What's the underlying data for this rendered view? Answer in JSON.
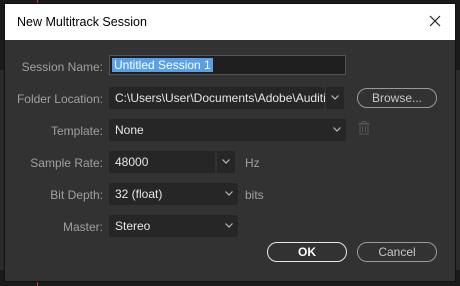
{
  "dialog": {
    "title": "New Multitrack Session",
    "close_icon": "close-icon"
  },
  "form": {
    "session_name_label": "Session Name:",
    "session_name_value": "Untitled Session 1",
    "folder_location_label": "Folder Location:",
    "folder_location_value": "C:\\Users\\User\\Documents\\Adobe\\Auditi...",
    "browse_label": "Browse...",
    "template_label": "Template:",
    "template_value": "None",
    "sample_rate_label": "Sample Rate:",
    "sample_rate_value": "48000",
    "sample_rate_unit": "Hz",
    "bit_depth_label": "Bit Depth:",
    "bit_depth_value": "32 (float)",
    "bit_depth_unit": "bits",
    "master_label": "Master:",
    "master_value": "Stereo"
  },
  "buttons": {
    "ok_label": "OK",
    "cancel_label": "Cancel"
  },
  "colors": {
    "selection": "#5aa0e6",
    "dialog_bg": "#323232",
    "field_bg": "#262626"
  }
}
